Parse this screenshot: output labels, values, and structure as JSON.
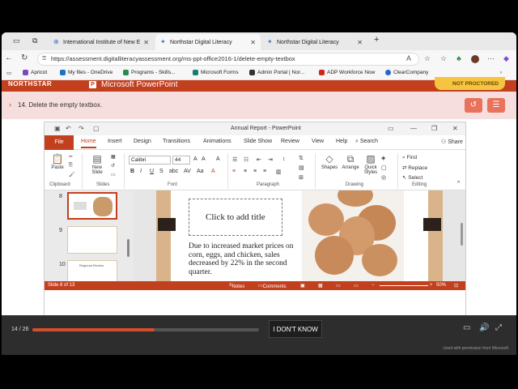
{
  "browser": {
    "tabs": [
      {
        "label": "International Institute of New E"
      },
      {
        "label": "Northstar Digital Literacy"
      },
      {
        "label": "Northstar Digital Literacy"
      }
    ],
    "url": "https://assessment.digitalliteracyassessment.org/ms-ppt-office2016-1/delete-empty-textbox",
    "bookmarks": [
      {
        "label": "Apricot",
        "color": "#7c4bb8"
      },
      {
        "label": "My files - OneDrive",
        "color": "#1f6fc4"
      },
      {
        "label": "Programs - Skills...",
        "color": "#2a8a4b"
      },
      {
        "label": "Microsoft Forms",
        "color": "#1a7d6b"
      },
      {
        "label": "Admin Portal | Nor...",
        "color": "#333333"
      },
      {
        "label": "ADP Workforce Now",
        "color": "#d0271d"
      },
      {
        "label": "ClearCompany",
        "color": "#2266cc"
      }
    ]
  },
  "northstar": {
    "logo": "NORTHSTAR",
    "app_title": "Microsoft PowerPoint",
    "proctor_label": "NOT PROCTORED",
    "task": "14. Delete the empty textbox."
  },
  "ppt": {
    "doc_title": "Annual Report - PowerPoint",
    "tabs": [
      "File",
      "Home",
      "Insert",
      "Design",
      "Transitions",
      "Animations",
      "Slide Show",
      "Review",
      "View",
      "Help"
    ],
    "search_label": "Search",
    "share_label": "Share",
    "font_name": "Calibri",
    "font_size": "44",
    "groups": {
      "clipboard": "Clipboard",
      "slides": "Slides",
      "font": "Font",
      "paragraph": "Paragraph",
      "drawing": "Drawing",
      "editing": "Editing"
    },
    "buttons": {
      "paste": "Paste",
      "new_slide": "New Slide",
      "shapes": "Shapes",
      "arrange": "Arrange",
      "quick_styles": "Quick Styles",
      "find": "Find",
      "replace": "Replace",
      "select": "Select"
    },
    "thumb_numbers": [
      "8",
      "9",
      "10"
    ],
    "thumb_10_title": "Regional Review",
    "slide": {
      "title_placeholder": "Click to add title",
      "body": "Due to increased market prices on corn, eggs, and chicken, sales decreased by 22% in the second quarter."
    },
    "status": {
      "slide_count": "Slide 8 of 13",
      "notes": "Notes",
      "comments": "Comments",
      "zoom": "50%"
    }
  },
  "assessment": {
    "progress_label": "14 / 26",
    "progress_fraction": 0.54,
    "dont_know_label": "I DON'T KNOW",
    "permission_text": "Used with permission from Microsoft"
  }
}
